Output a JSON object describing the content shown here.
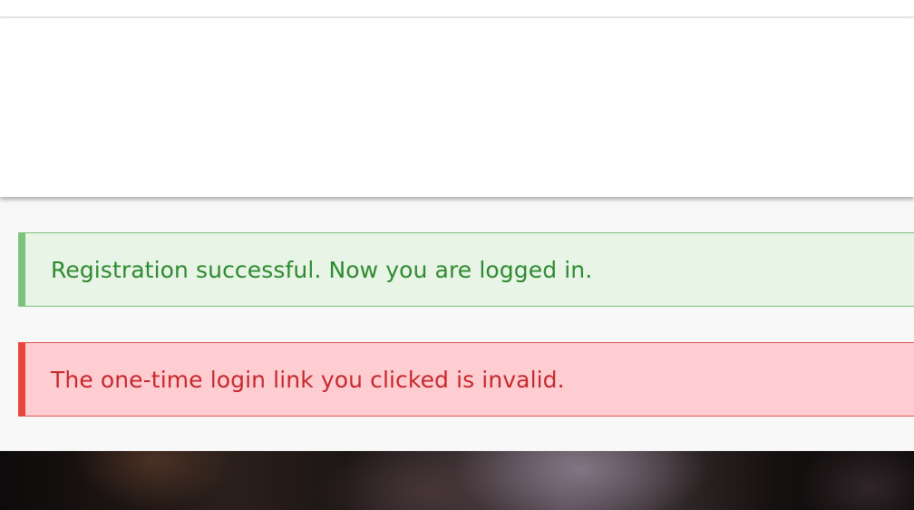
{
  "messages": {
    "success": "Registration successful. Now you are logged in.",
    "error": "The one-time login link you clicked is invalid."
  },
  "colors": {
    "success_background": "#e7f4e6",
    "success_accent": "#7ec27c",
    "success_text": "#2e8a30",
    "error_background": "#fecdd2",
    "error_accent": "#e8453c",
    "error_text": "#c6282c"
  }
}
